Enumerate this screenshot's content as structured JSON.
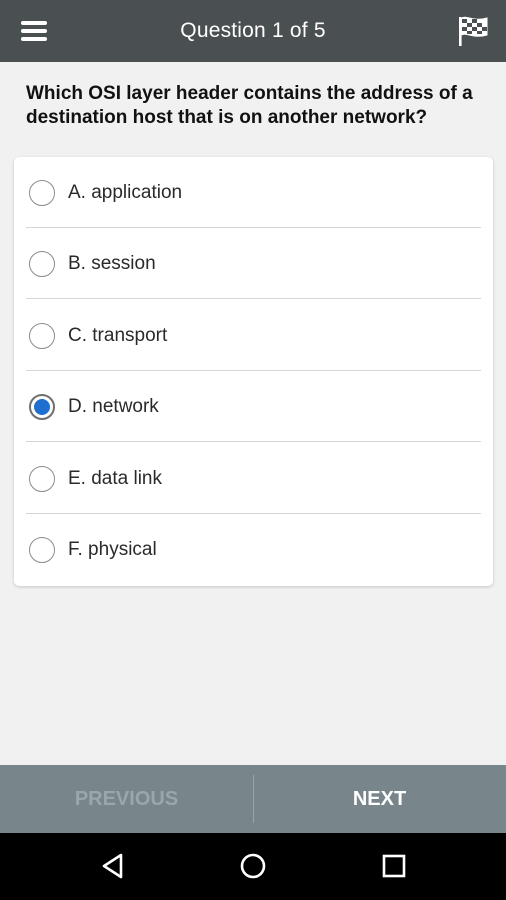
{
  "header": {
    "title": "Question 1 of 5",
    "menu_icon": "hamburger-menu-icon",
    "flag_icon": "checkered-flag-icon"
  },
  "question": {
    "text": "Which OSI layer header contains the address of a destination host that is on another network?"
  },
  "options": [
    {
      "label": "A. application",
      "selected": false
    },
    {
      "label": "B. session",
      "selected": false
    },
    {
      "label": "C. transport",
      "selected": false
    },
    {
      "label": "D. network",
      "selected": true
    },
    {
      "label": "E. data link",
      "selected": false
    },
    {
      "label": "F. physical",
      "selected": false
    }
  ],
  "footer": {
    "previous_label": "PREVIOUS",
    "next_label": "NEXT"
  },
  "system_nav": {
    "back_icon": "back-triangle-icon",
    "home_icon": "home-circle-icon",
    "recents_icon": "recents-square-icon"
  },
  "colors": {
    "header_bg": "#4a5051",
    "footer_bg": "#78868b",
    "accent": "#1e6fd0",
    "background": "#f1f1f1"
  }
}
